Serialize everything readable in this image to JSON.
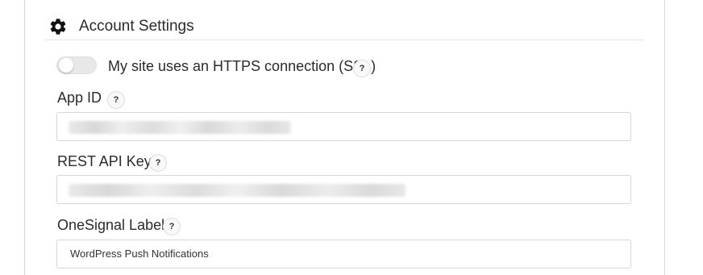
{
  "section": {
    "title": "Account Settings",
    "icon": "gear-icon"
  },
  "ssl": {
    "label": "My site uses an HTTPS connection (SSL)",
    "enabled": false,
    "help": "?"
  },
  "app_id": {
    "label": "App ID",
    "help": "?"
  },
  "rest_api_key": {
    "label": "REST API Key",
    "help": "?"
  },
  "onesignal_label": {
    "label": "OneSignal Label",
    "help": "?",
    "value": "WordPress Push Notifications"
  },
  "colors": {
    "text": "#2b2b2b",
    "border": "#d6d6d6"
  }
}
